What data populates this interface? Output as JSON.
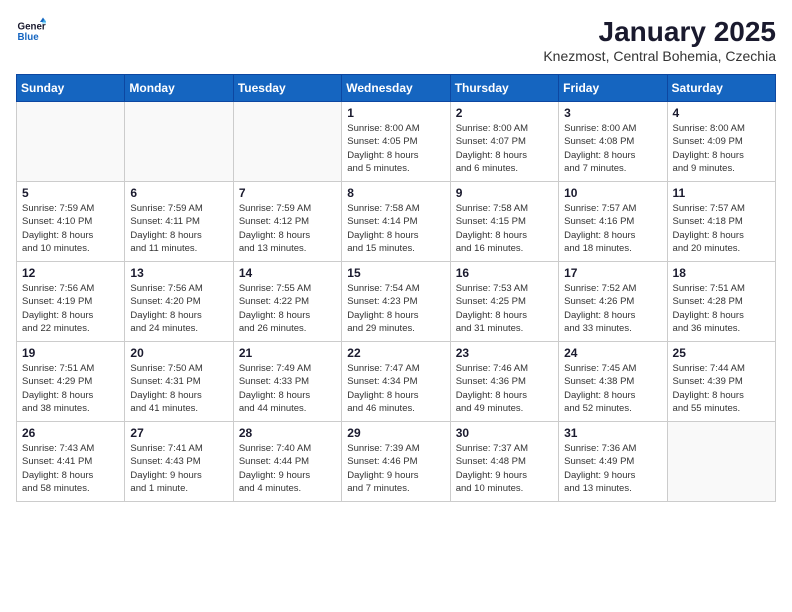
{
  "header": {
    "logo_line1": "General",
    "logo_line2": "Blue",
    "title": "January 2025",
    "subtitle": "Knezmost, Central Bohemia, Czechia"
  },
  "weekdays": [
    "Sunday",
    "Monday",
    "Tuesday",
    "Wednesday",
    "Thursday",
    "Friday",
    "Saturday"
  ],
  "weeks": [
    [
      {
        "day": "",
        "info": ""
      },
      {
        "day": "",
        "info": ""
      },
      {
        "day": "",
        "info": ""
      },
      {
        "day": "1",
        "info": "Sunrise: 8:00 AM\nSunset: 4:05 PM\nDaylight: 8 hours\nand 5 minutes."
      },
      {
        "day": "2",
        "info": "Sunrise: 8:00 AM\nSunset: 4:07 PM\nDaylight: 8 hours\nand 6 minutes."
      },
      {
        "day": "3",
        "info": "Sunrise: 8:00 AM\nSunset: 4:08 PM\nDaylight: 8 hours\nand 7 minutes."
      },
      {
        "day": "4",
        "info": "Sunrise: 8:00 AM\nSunset: 4:09 PM\nDaylight: 8 hours\nand 9 minutes."
      }
    ],
    [
      {
        "day": "5",
        "info": "Sunrise: 7:59 AM\nSunset: 4:10 PM\nDaylight: 8 hours\nand 10 minutes."
      },
      {
        "day": "6",
        "info": "Sunrise: 7:59 AM\nSunset: 4:11 PM\nDaylight: 8 hours\nand 11 minutes."
      },
      {
        "day": "7",
        "info": "Sunrise: 7:59 AM\nSunset: 4:12 PM\nDaylight: 8 hours\nand 13 minutes."
      },
      {
        "day": "8",
        "info": "Sunrise: 7:58 AM\nSunset: 4:14 PM\nDaylight: 8 hours\nand 15 minutes."
      },
      {
        "day": "9",
        "info": "Sunrise: 7:58 AM\nSunset: 4:15 PM\nDaylight: 8 hours\nand 16 minutes."
      },
      {
        "day": "10",
        "info": "Sunrise: 7:57 AM\nSunset: 4:16 PM\nDaylight: 8 hours\nand 18 minutes."
      },
      {
        "day": "11",
        "info": "Sunrise: 7:57 AM\nSunset: 4:18 PM\nDaylight: 8 hours\nand 20 minutes."
      }
    ],
    [
      {
        "day": "12",
        "info": "Sunrise: 7:56 AM\nSunset: 4:19 PM\nDaylight: 8 hours\nand 22 minutes."
      },
      {
        "day": "13",
        "info": "Sunrise: 7:56 AM\nSunset: 4:20 PM\nDaylight: 8 hours\nand 24 minutes."
      },
      {
        "day": "14",
        "info": "Sunrise: 7:55 AM\nSunset: 4:22 PM\nDaylight: 8 hours\nand 26 minutes."
      },
      {
        "day": "15",
        "info": "Sunrise: 7:54 AM\nSunset: 4:23 PM\nDaylight: 8 hours\nand 29 minutes."
      },
      {
        "day": "16",
        "info": "Sunrise: 7:53 AM\nSunset: 4:25 PM\nDaylight: 8 hours\nand 31 minutes."
      },
      {
        "day": "17",
        "info": "Sunrise: 7:52 AM\nSunset: 4:26 PM\nDaylight: 8 hours\nand 33 minutes."
      },
      {
        "day": "18",
        "info": "Sunrise: 7:51 AM\nSunset: 4:28 PM\nDaylight: 8 hours\nand 36 minutes."
      }
    ],
    [
      {
        "day": "19",
        "info": "Sunrise: 7:51 AM\nSunset: 4:29 PM\nDaylight: 8 hours\nand 38 minutes."
      },
      {
        "day": "20",
        "info": "Sunrise: 7:50 AM\nSunset: 4:31 PM\nDaylight: 8 hours\nand 41 minutes."
      },
      {
        "day": "21",
        "info": "Sunrise: 7:49 AM\nSunset: 4:33 PM\nDaylight: 8 hours\nand 44 minutes."
      },
      {
        "day": "22",
        "info": "Sunrise: 7:47 AM\nSunset: 4:34 PM\nDaylight: 8 hours\nand 46 minutes."
      },
      {
        "day": "23",
        "info": "Sunrise: 7:46 AM\nSunset: 4:36 PM\nDaylight: 8 hours\nand 49 minutes."
      },
      {
        "day": "24",
        "info": "Sunrise: 7:45 AM\nSunset: 4:38 PM\nDaylight: 8 hours\nand 52 minutes."
      },
      {
        "day": "25",
        "info": "Sunrise: 7:44 AM\nSunset: 4:39 PM\nDaylight: 8 hours\nand 55 minutes."
      }
    ],
    [
      {
        "day": "26",
        "info": "Sunrise: 7:43 AM\nSunset: 4:41 PM\nDaylight: 8 hours\nand 58 minutes."
      },
      {
        "day": "27",
        "info": "Sunrise: 7:41 AM\nSunset: 4:43 PM\nDaylight: 9 hours\nand 1 minute."
      },
      {
        "day": "28",
        "info": "Sunrise: 7:40 AM\nSunset: 4:44 PM\nDaylight: 9 hours\nand 4 minutes."
      },
      {
        "day": "29",
        "info": "Sunrise: 7:39 AM\nSunset: 4:46 PM\nDaylight: 9 hours\nand 7 minutes."
      },
      {
        "day": "30",
        "info": "Sunrise: 7:37 AM\nSunset: 4:48 PM\nDaylight: 9 hours\nand 10 minutes."
      },
      {
        "day": "31",
        "info": "Sunrise: 7:36 AM\nSunset: 4:49 PM\nDaylight: 9 hours\nand 13 minutes."
      },
      {
        "day": "",
        "info": ""
      }
    ]
  ]
}
